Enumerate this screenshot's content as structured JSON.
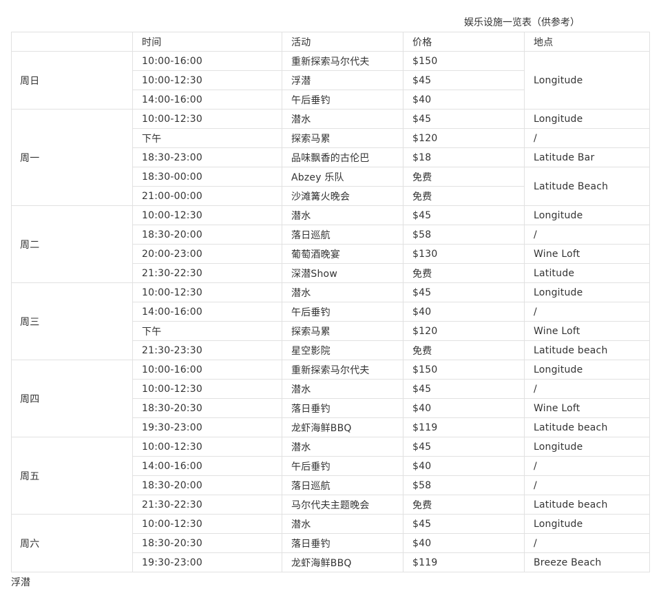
{
  "caption": "娱乐设施一览表（供参考）",
  "headers": {
    "day": "",
    "time": "时间",
    "activity": "活动",
    "price": "价格",
    "location": "地点"
  },
  "days": [
    {
      "day": "周日",
      "rows": [
        {
          "time": "10:00-16:00",
          "activity": "重新探索马尔代夫",
          "price": "$150"
        },
        {
          "time": "10:00-12:30",
          "activity": "浮潜",
          "price": "$45"
        },
        {
          "time": "14:00-16:00",
          "activity": "午后垂钓",
          "price": "$40"
        }
      ],
      "locations": [
        {
          "text": "Longitude",
          "span": 3
        }
      ]
    },
    {
      "day": "周一",
      "rows": [
        {
          "time": "10:00-12:30",
          "activity": "潜水",
          "price": "$45"
        },
        {
          "time": "下午",
          "activity": "探索马累",
          "price": "$120"
        },
        {
          "time": "18:30-23:00",
          "activity": "品味飘香的古伦巴",
          "price": "$18"
        },
        {
          "time": "18:30-00:00",
          "activity": "Abzey 乐队",
          "price": "免费"
        },
        {
          "time": "21:00-00:00",
          "activity": "沙滩篝火晚会",
          "price": "免费"
        }
      ],
      "locations": [
        {
          "text": "Longitude",
          "span": 1
        },
        {
          "text": "/",
          "span": 1
        },
        {
          "text": "Latitude Bar",
          "span": 1
        },
        {
          "text": "Latitude Beach",
          "span": 2
        }
      ]
    },
    {
      "day": "周二",
      "rows": [
        {
          "time": "10:00-12:30",
          "activity": "潜水",
          "price": "$45"
        },
        {
          "time": "18:30-20:00",
          "activity": "落日巡航",
          "price": "$58"
        },
        {
          "time": "20:00-23:00",
          "activity": "葡萄酒晚宴",
          "price": "$130"
        },
        {
          "time": "21:30-22:30",
          "activity": "深潜Show",
          "price": "免费"
        }
      ],
      "locations": [
        {
          "text": "Longitude",
          "span": 1
        },
        {
          "text": "/",
          "span": 1
        },
        {
          "text": "Wine Loft",
          "span": 1
        },
        {
          "text": "Latitude",
          "span": 1
        }
      ]
    },
    {
      "day": "周三",
      "rows": [
        {
          "time": "10:00-12:30",
          "activity": "潜水",
          "price": "$45"
        },
        {
          "time": "14:00-16:00",
          "activity": "午后垂钓",
          "price": "$40"
        },
        {
          "time": "下午",
          "activity": "探索马累",
          "price": "$120"
        },
        {
          "time": "21:30-23:30",
          "activity": "星空影院",
          "price": "免费"
        }
      ],
      "locations": [
        {
          "text": "Longitude",
          "span": 1
        },
        {
          "text": "/",
          "span": 1
        },
        {
          "text": "Wine Loft",
          "span": 1
        },
        {
          "text": "Latitude beach",
          "span": 1
        }
      ]
    },
    {
      "day": "周四",
      "rows": [
        {
          "time": "10:00-16:00",
          "activity": "重新探索马尔代夫",
          "price": "$150"
        },
        {
          "time": "10:00-12:30",
          "activity": "潜水",
          "price": "$45"
        },
        {
          "time": "18:30-20:30",
          "activity": "落日垂钓",
          "price": "$40"
        },
        {
          "time": "19:30-23:00",
          "activity": "龙虾海鲜BBQ",
          "price": "$119"
        }
      ],
      "locations": [
        {
          "text": "Longitude",
          "span": 1
        },
        {
          "text": "/",
          "span": 1
        },
        {
          "text": "Wine Loft",
          "span": 1
        },
        {
          "text": "Latitude beach",
          "span": 1
        }
      ]
    },
    {
      "day": "周五",
      "rows": [
        {
          "time": "10:00-12:30",
          "activity": "潜水",
          "price": "$45"
        },
        {
          "time": "14:00-16:00",
          "activity": "午后垂钓",
          "price": "$40"
        },
        {
          "time": "18:30-20:00",
          "activity": "落日巡航",
          "price": "$58"
        },
        {
          "time": "21:30-22:30",
          "activity": "马尔代夫主题晚会",
          "price": "免费"
        }
      ],
      "locations": [
        {
          "text": "Longitude",
          "span": 1
        },
        {
          "text": "/",
          "span": 1
        },
        {
          "text": "/",
          "span": 1
        },
        {
          "text": "Latitude beach",
          "span": 1
        }
      ]
    },
    {
      "day": "周六",
      "rows": [
        {
          "time": "10:00-12:30",
          "activity": "潜水",
          "price": "$45"
        },
        {
          "time": "18:30-20:30",
          "activity": "落日垂钓",
          "price": "$40"
        },
        {
          "time": "19:30-23:00",
          "activity": "龙虾海鲜BBQ",
          "price": "$119"
        }
      ],
      "locations": [
        {
          "text": "Longitude",
          "span": 1
        },
        {
          "text": "/",
          "span": 1
        },
        {
          "text": "Breeze Beach",
          "span": 1
        }
      ]
    }
  ],
  "footer": "浮潜"
}
